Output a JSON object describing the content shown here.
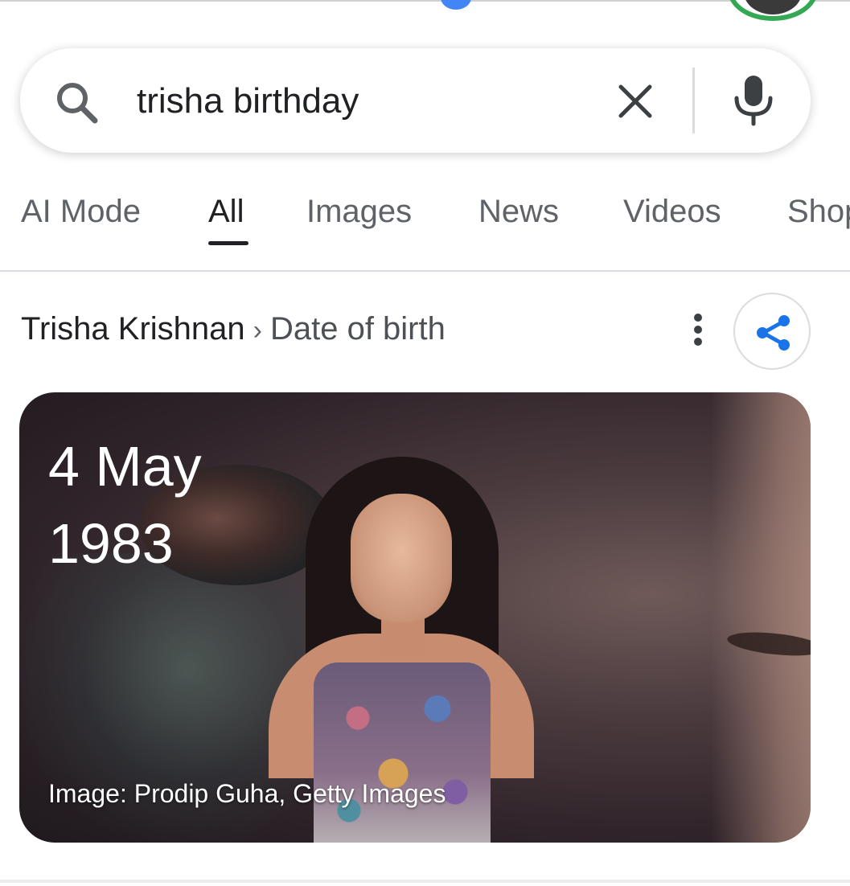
{
  "search": {
    "query": "trisha birthday"
  },
  "tabs": [
    {
      "label": "AI Mode"
    },
    {
      "label": "All"
    },
    {
      "label": "Images"
    },
    {
      "label": "News"
    },
    {
      "label": "Videos"
    },
    {
      "label": "Shop"
    }
  ],
  "active_tab": "All",
  "result": {
    "entity": "Trisha Krishnan",
    "separator": "›",
    "attribute": "Date of birth",
    "date_line1": "4 May",
    "date_line2": "1983",
    "image_credit": "Image: Prodip Guha, Getty Images"
  },
  "icons": {
    "search": "search-icon",
    "clear": "close-icon",
    "mic": "mic-icon",
    "more": "more-vert-icon",
    "share": "share-icon"
  },
  "colors": {
    "share_accent": "#1a73e8",
    "active_tab": "#202124",
    "inactive_tab": "#5f6368"
  }
}
